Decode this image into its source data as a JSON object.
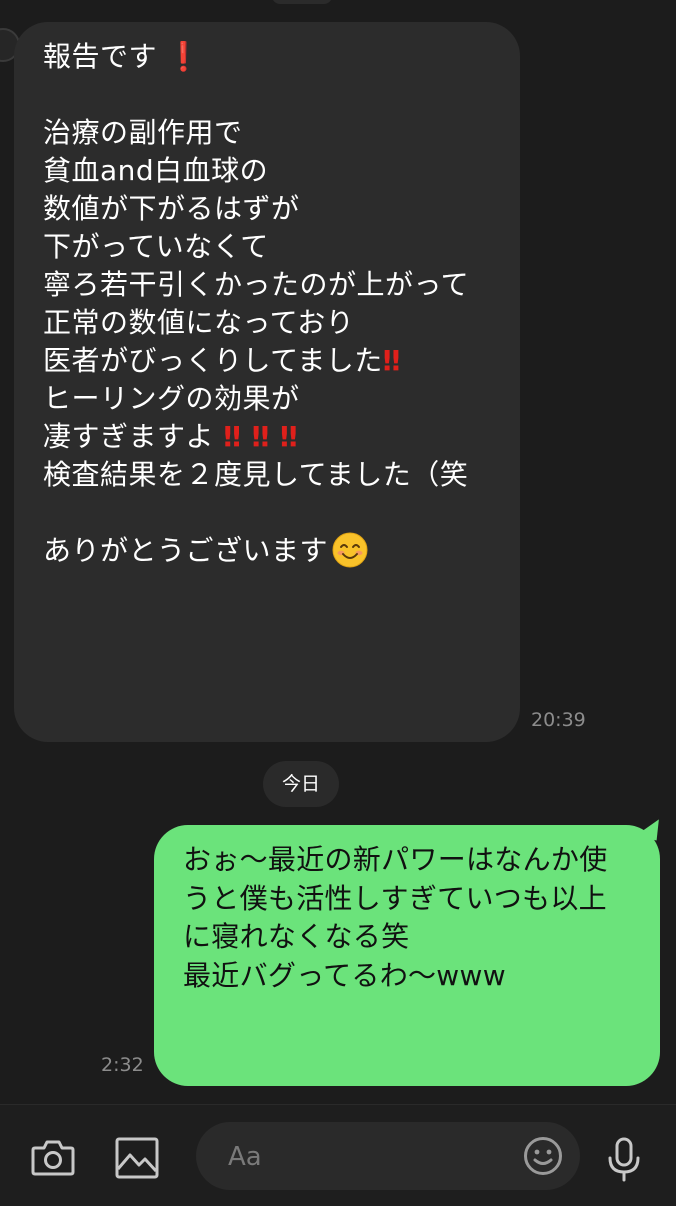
{
  "conversation": {
    "incoming_message": {
      "lines": [
        {
          "text": "報告です",
          "suffix": "❗"
        },
        {
          "text": ""
        },
        {
          "text": "治療の副作用で"
        },
        {
          "text": "貧血and白血球の"
        },
        {
          "text": "数値が下がるはずが"
        },
        {
          "text": "下がっていなくて"
        },
        {
          "text": "寧ろ若干引くかったのが上がって"
        },
        {
          "text": "正常の数値になっており"
        },
        {
          "text": "医者がびっくりしてました",
          "suffix": "‼"
        },
        {
          "text": "ヒーリングの効果が"
        },
        {
          "text": "凄すぎますよ",
          "suffix": "‼ ‼ ‼"
        },
        {
          "text": "検査結果を２度見してました（笑"
        },
        {
          "text": ""
        },
        {
          "text": "ありがとうございます",
          "emoji": "smiling-face"
        }
      ],
      "time": "20:39"
    },
    "date_separator": "今日",
    "outgoing_message": {
      "lines": [
        "おぉ〜最近の新パワーはなんか使",
        "うと僕も活性しすぎていつも以上",
        "に寝れなくなる笑",
        "最近バグってるわ〜www"
      ],
      "time": "2:32"
    }
  },
  "input_bar": {
    "placeholder": "Aa",
    "icons": {
      "camera": "camera-icon",
      "image": "image-icon",
      "emoji": "emoji-icon",
      "mic": "microphone-icon"
    }
  },
  "colors": {
    "background": "#1c1c1c",
    "incoming_bubble": "#2c2c2c",
    "outgoing_bubble": "#6be37b",
    "exclamation": "#e0201b",
    "timestamp": "#8c8c8c"
  }
}
